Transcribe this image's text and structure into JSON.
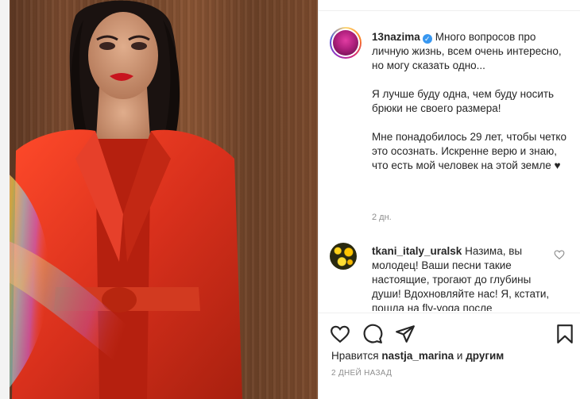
{
  "post": {
    "author": {
      "username": "13nazima",
      "verified_mark": "✓",
      "avatar_icon": "profile-avatar-icon"
    },
    "caption": {
      "paragraphs": [
        "Много вопросов про личную жизнь, всем очень интересно, но могу сказать одно...",
        "Я лучше буду одна, чем буду носить брюки не своего размера!",
        "",
        "Мне понадобилось 29 лет, чтобы четко это осознать. Искренне  верю и знаю, что есть мой человек на этой земле ♥"
      ],
      "time": "2 дн."
    },
    "comment": {
      "username": "tkani_italy_uralsk",
      "text": "Назима, вы молодец! Ваши песни такие настоящие, трогают до глубины души! Вдохновляйте нас! Я, кстати, пошла на fly-yoga после"
    },
    "actions": {
      "icons": [
        "heart-icon",
        "comment-icon",
        "share-icon",
        "bookmark-icon"
      ]
    },
    "likes": {
      "prefix": "Нравится",
      "user": "nastja_marina",
      "middle": "и",
      "suffix": "другим"
    },
    "date": "2 дней назад"
  }
}
